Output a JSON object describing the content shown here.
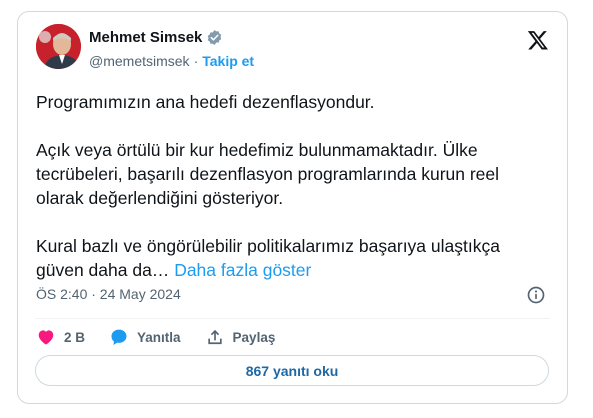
{
  "author": {
    "name": "Mehmet Simsek",
    "handle": "@memetsimsek",
    "separator": "·",
    "follow_label": "Takip et"
  },
  "tweet": {
    "paragraph1": "Programımızın ana hedefi dezenflasyondur.",
    "paragraph2": "Açık veya örtülü bir kur hedefimiz bulunmamaktadır. Ülke tecrübeleri, başarılı dezenflasyon programlarında kurun reel olarak değerlendiğini gösteriyor.",
    "paragraph3": "Kural bazlı ve öngörülebilir politikalarımız başarıya ulaştıkça güven daha da…",
    "show_more": "Daha fazla göster",
    "timestamp": "ÖS 2:40 · 24 May 2024"
  },
  "actions": {
    "likes": "2 B",
    "reply_label": "Yanıtla",
    "share_label": "Paylaş"
  },
  "replies_button": "867 yanıtı oku",
  "colors": {
    "accent": "#1d9bf0",
    "like": "#f91880",
    "text": "#0f1419",
    "muted": "#536471"
  },
  "icons": [
    "verified-badge-icon",
    "x-logo-icon",
    "info-icon",
    "heart-icon",
    "reply-icon",
    "share-icon"
  ]
}
